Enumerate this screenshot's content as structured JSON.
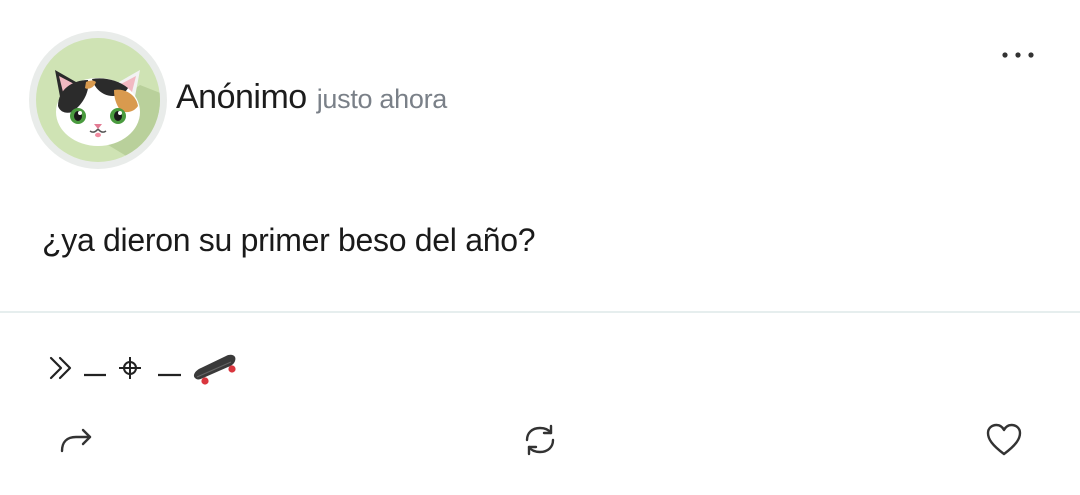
{
  "post": {
    "author": "Anónimo",
    "time": "justo ahora",
    "text": "¿ya dieron su primer beso del año?",
    "avatar": "calico-cat-avatar",
    "signature": {
      "glyphs": [
        "chevrons-right-icon",
        "dash",
        "crosshair-icon",
        "dash",
        "skateboard-icon"
      ]
    }
  },
  "toolbar": {
    "more_icon": "more-dots-icon",
    "share_icon": "share-arrow-icon",
    "repost_icon": "repost-icon",
    "like_icon": "heart-icon"
  },
  "colors": {
    "avatar_background": "#cfe3b4",
    "avatar_ring": "#e9ecea",
    "muted_text": "#7a8088",
    "divider": "#e6eeee",
    "icon": "#333333"
  }
}
